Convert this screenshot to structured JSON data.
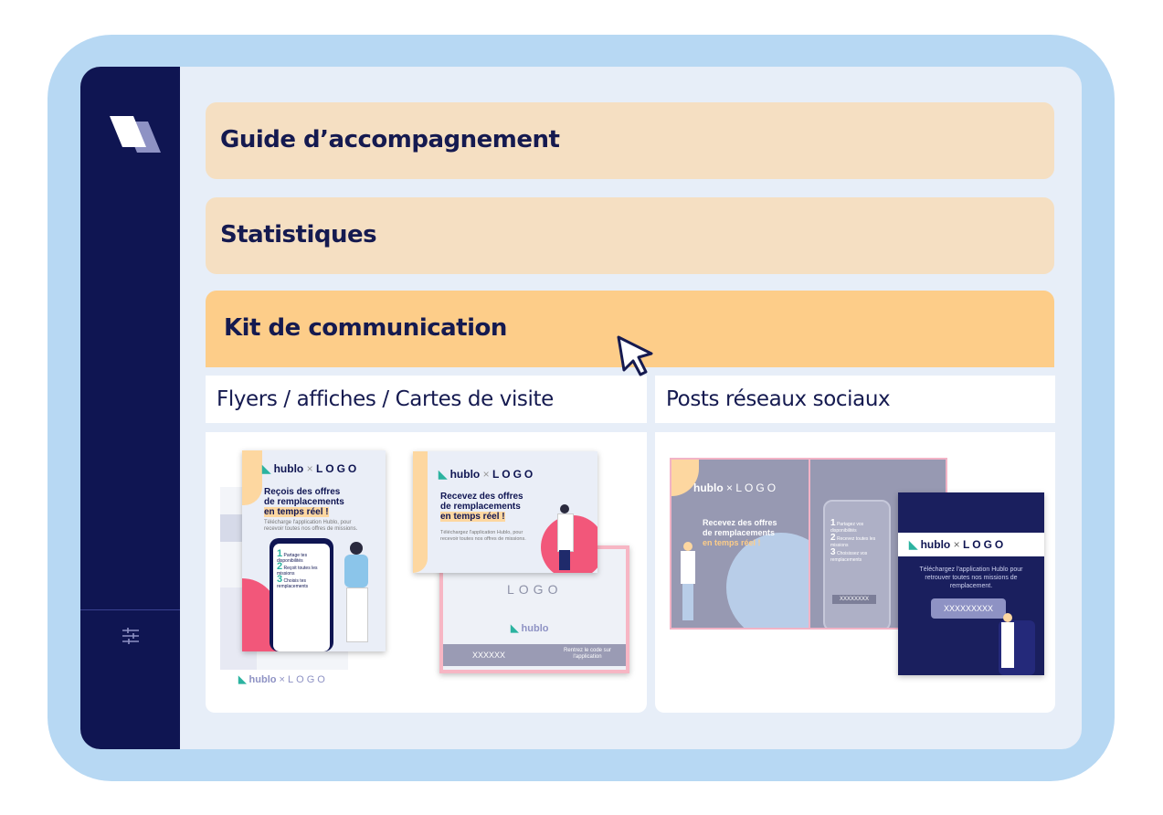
{
  "sections": {
    "guide": {
      "title": "Guide d’accompagnement"
    },
    "stats": {
      "title": "Statistiques"
    },
    "kit": {
      "title": "Kit de communication"
    }
  },
  "kit": {
    "col1_title": "Flyers / affiches / Cartes de visite",
    "col2_title": "Posts réseaux sociaux"
  },
  "brand": {
    "hublo": "hublo",
    "x": "×",
    "logo": "LOGO"
  },
  "flyer": {
    "headline1": "Reçois des offres",
    "headline2": "de remplacements",
    "headline3": "en temps réel !",
    "sub": "Télécharge l'application Hublo, pour recevoir toutes nos offres de missions.",
    "step1": "Partage tes disponibilités",
    "step2": "Reçoit toutes les missions",
    "step3": "Choisis tes remplacements"
  },
  "card": {
    "headline1": "Recevez des offres",
    "headline2": "de remplacements",
    "headline3": "en temps réel !",
    "sub": "Téléchargez l'application Hublo, pour recevoir toutes nos offres de missions.",
    "code": "XXXXXX",
    "code_label": "Rentrez le code sur l'application"
  },
  "post": {
    "headline1": "Recevez des offres",
    "headline2": "de remplacements",
    "headline3": "en temps réel !",
    "dark_text": "Téléchargez l'application Hublo pour retrouver toutes nos missions de remplacement.",
    "code": "XXXXXXXXX",
    "code_small": "XXXXXXXX",
    "step1": "Partagez vos disponibilités",
    "step2": "Recevez toutes les missions",
    "step3": "Choisissez vos remplacements"
  },
  "colors": {
    "navy": "#0f1552",
    "peach": "#f5dfc2",
    "orange": "#fdcd89",
    "frame": "#b7d8f3",
    "teal": "#2bb3a0",
    "pink": "#f2577a"
  },
  "icons": [
    "hublo-logo-icon",
    "settings-sliders-icon",
    "cursor-arrow-icon"
  ]
}
